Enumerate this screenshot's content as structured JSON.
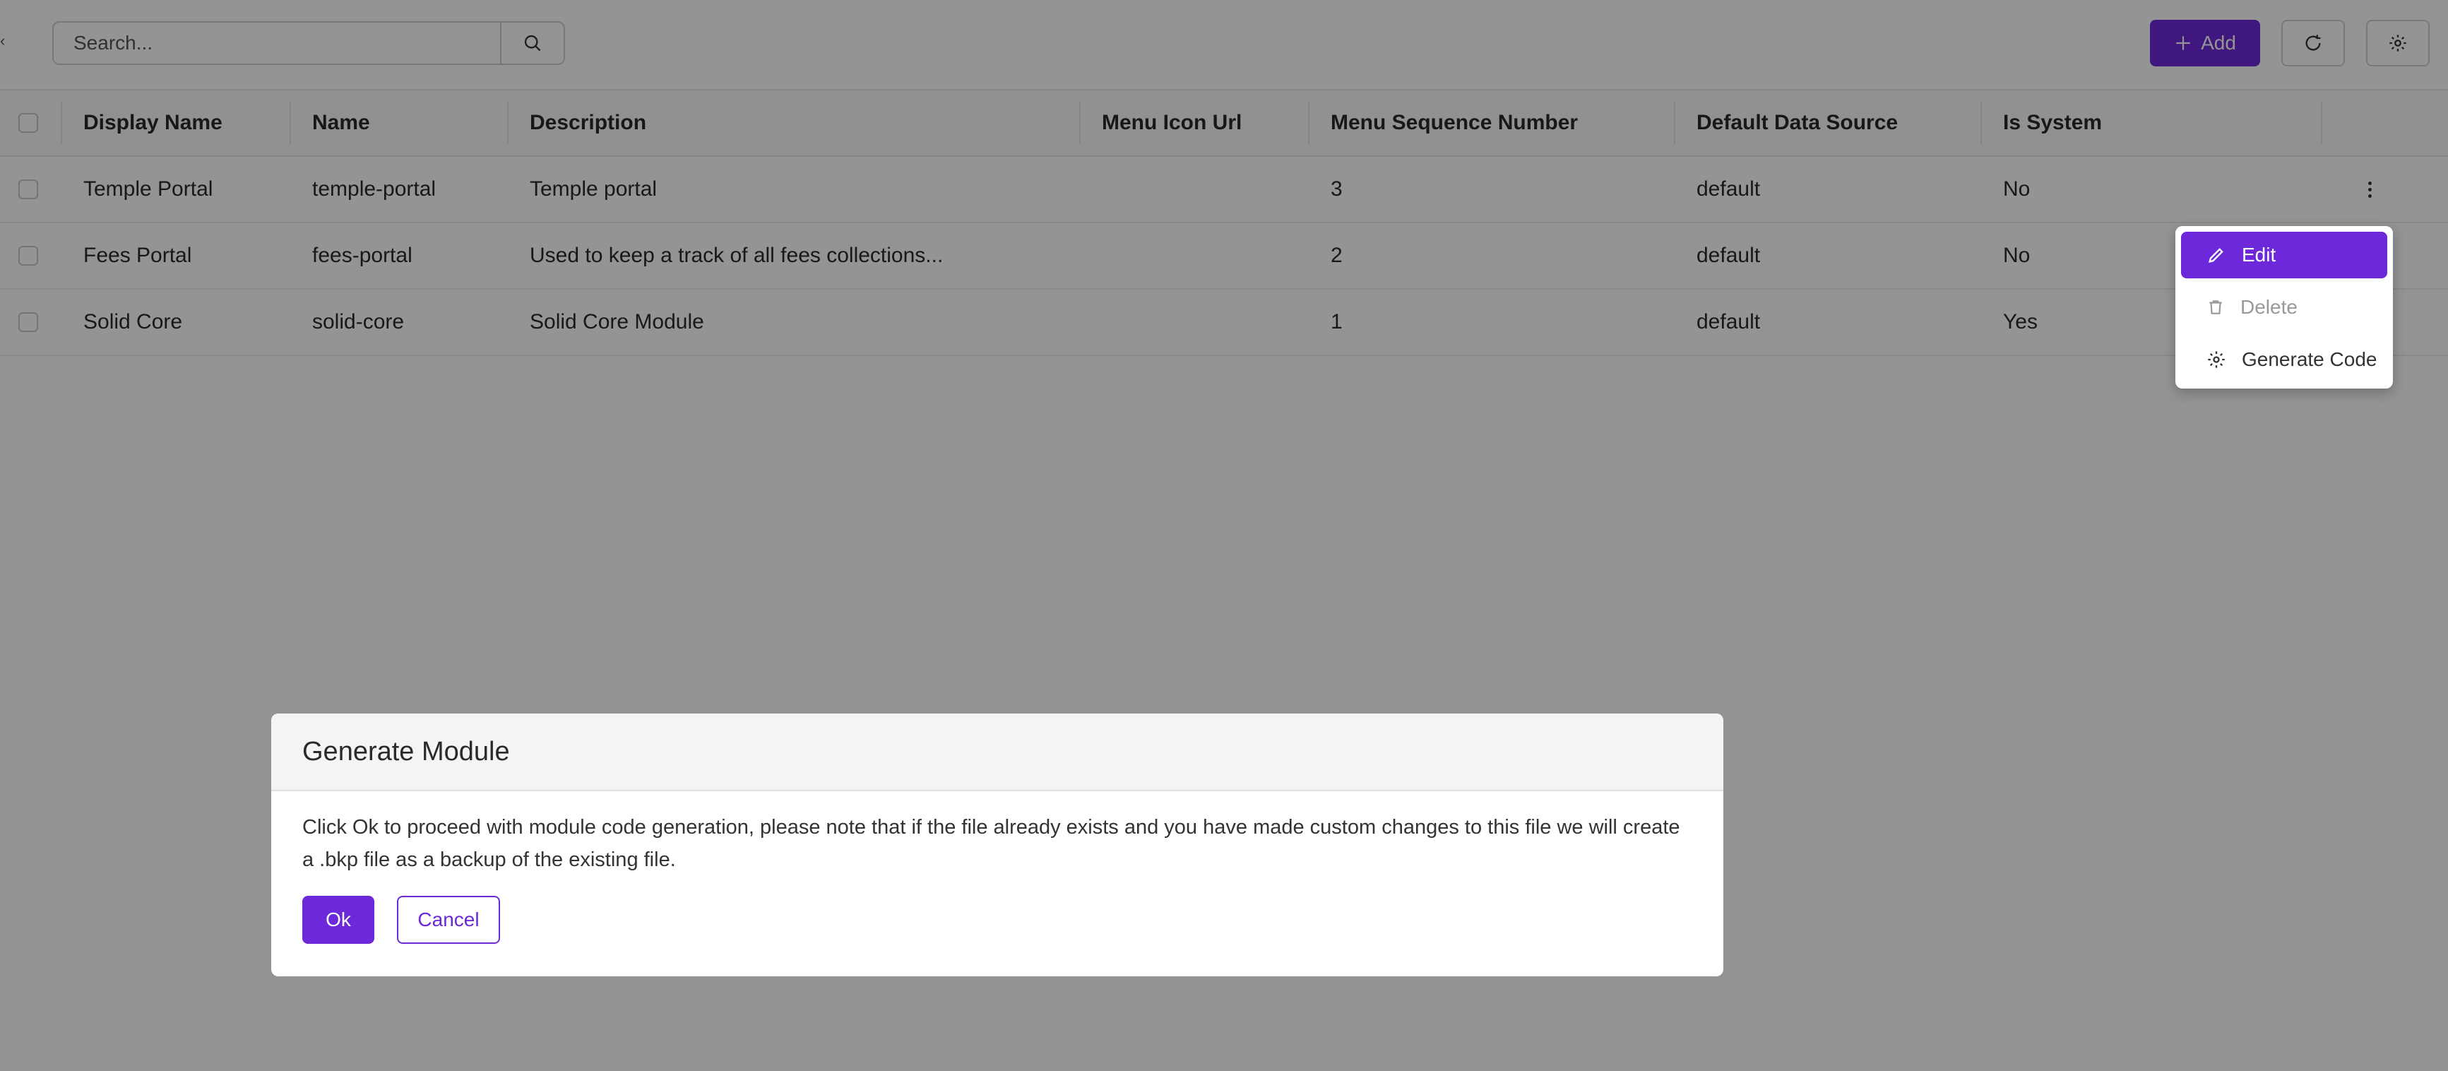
{
  "toolbar": {
    "collapse_glyph": "‹",
    "search_placeholder": "Search...",
    "add_label": "Add"
  },
  "table": {
    "headers": [
      "Display Name",
      "Name",
      "Description",
      "Menu Icon Url",
      "Menu Sequence Number",
      "Default Data Source",
      "Is System"
    ],
    "rows": [
      {
        "display_name": "Temple Portal",
        "name": "temple-portal",
        "description": "Temple portal",
        "menu_icon_url": "",
        "menu_sequence_number": "3",
        "default_data_source": "default",
        "is_system": "No"
      },
      {
        "display_name": "Fees Portal",
        "name": "fees-portal",
        "description": "Used to keep a track of all fees collections...",
        "menu_icon_url": "",
        "menu_sequence_number": "2",
        "default_data_source": "default",
        "is_system": "No"
      },
      {
        "display_name": "Solid Core",
        "name": "solid-core",
        "description": "Solid Core Module",
        "menu_icon_url": "",
        "menu_sequence_number": "1",
        "default_data_source": "default",
        "is_system": "Yes"
      }
    ]
  },
  "context_menu": {
    "items": [
      {
        "label": "Edit",
        "icon": "pencil-icon",
        "state": "active"
      },
      {
        "label": "Delete",
        "icon": "trash-icon",
        "state": "disabled"
      },
      {
        "label": "Generate Code",
        "icon": "gear-icon",
        "state": "normal"
      }
    ]
  },
  "dialog": {
    "title": "Generate Module",
    "message": "Click Ok to proceed with module code generation, please note that if the file already exists and you have made custom changes to this file we will create a .bkp file as a backup of the existing file.",
    "ok_label": "Ok",
    "cancel_label": "Cancel"
  },
  "colors": {
    "accent": "#6d28d9",
    "overlay": "rgba(0,0,0,0.42)"
  }
}
